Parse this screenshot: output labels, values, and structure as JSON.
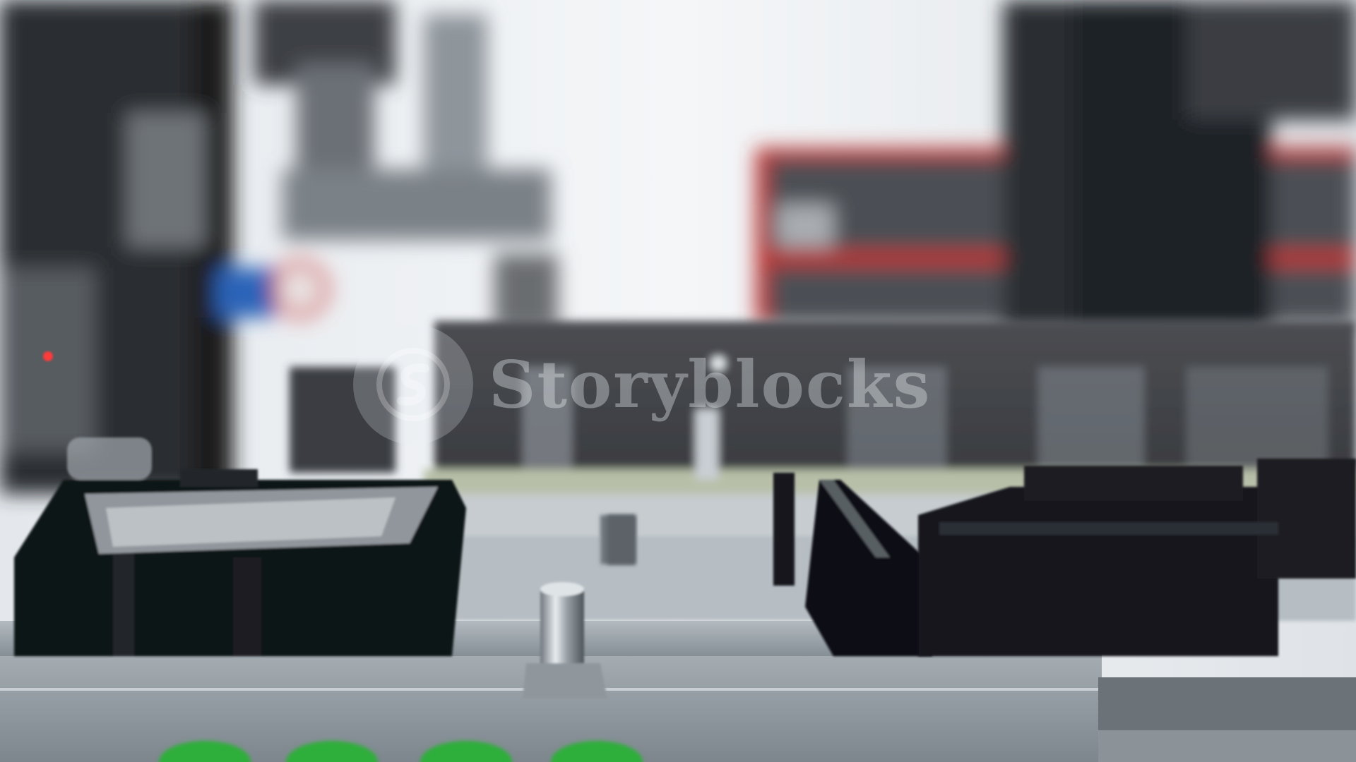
{
  "scene": {
    "description_kind": "photo",
    "colors": {
      "wall": "#f0f3f6",
      "dark_frame": "#1f2226",
      "red_shelf": "#c0312f",
      "steel": "#9aa3aa",
      "black_part": "#101114",
      "green_marker": "#2fae3a"
    }
  },
  "watermark": {
    "text": "Storyblocks",
    "icon": "storyblocks-logo-icon"
  }
}
